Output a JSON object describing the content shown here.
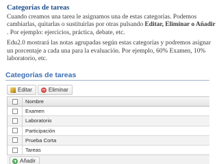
{
  "document": {
    "title": "Categorías de tareas",
    "para1_part1": "Cuando creamos una tarea le asignamos una de estas categorías. Podemos cambiarlas, quitarlas o sustituirlas por otras pulsando ",
    "para1_bold": "Editar, Eliminar o Añadir",
    "para1_part2": " . Por ejemplo: ejercicios, práctica, debate, etc.",
    "para2": "Edu2.0 mostrará las notas agrupadas según estas categorías y podremos asignar un porcentaje a cada una para la evaluación. Por ejemplo, 60% Examen, 10% laboratorio, etc."
  },
  "screenshot": {
    "title": "Categorías de tareas",
    "toolbar": {
      "edit_label": "Editar",
      "delete_label": "Eliminar"
    },
    "table": {
      "header": "Nombre",
      "rows": [
        "Examen",
        "Laboratorio",
        "Participación",
        "Prueba Corta",
        "Tareas"
      ]
    },
    "add_label": "Añadir",
    "icons": {
      "edit": "pencil-icon",
      "delete": "delete-icon",
      "add": "add-icon"
    }
  }
}
